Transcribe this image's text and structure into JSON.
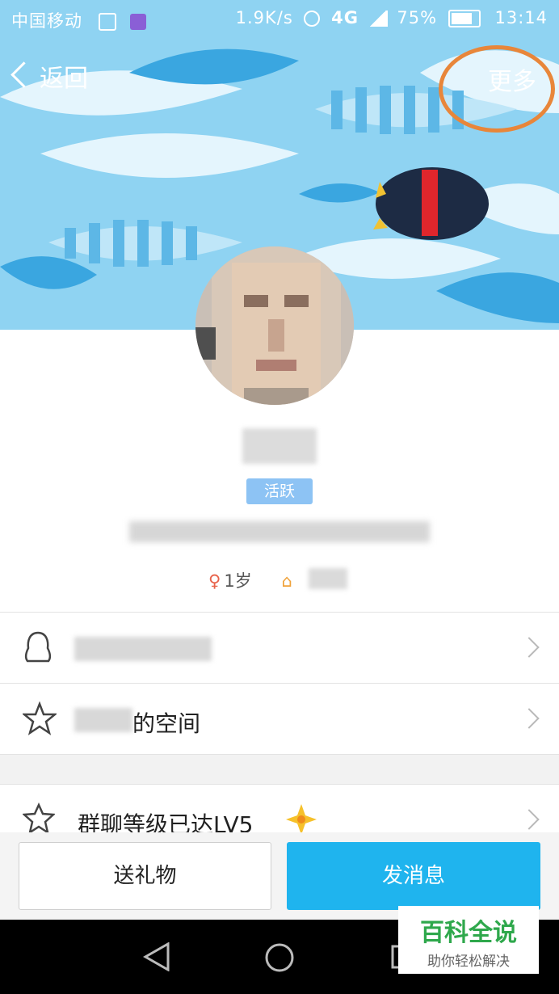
{
  "status_bar": {
    "carrier": "中国移动",
    "speed": "1.9K/s",
    "network": "4G",
    "battery": "75%",
    "time": "13:14"
  },
  "nav": {
    "back_label": "返回",
    "more_label": "更多"
  },
  "profile": {
    "status_badge": "活跃",
    "age": "1岁"
  },
  "list": {
    "space_suffix": "的空间",
    "group_level": "群聊等级已达LV5"
  },
  "actions": {
    "gift_label": "送礼物",
    "message_label": "发消息"
  },
  "watermark": {
    "title": "百科全说",
    "subtitle": "助你轻松解决"
  },
  "colors": {
    "accent_blue": "#1fb4ee",
    "badge_blue": "#8dc3f4",
    "highlight_orange": "#e8863a"
  }
}
